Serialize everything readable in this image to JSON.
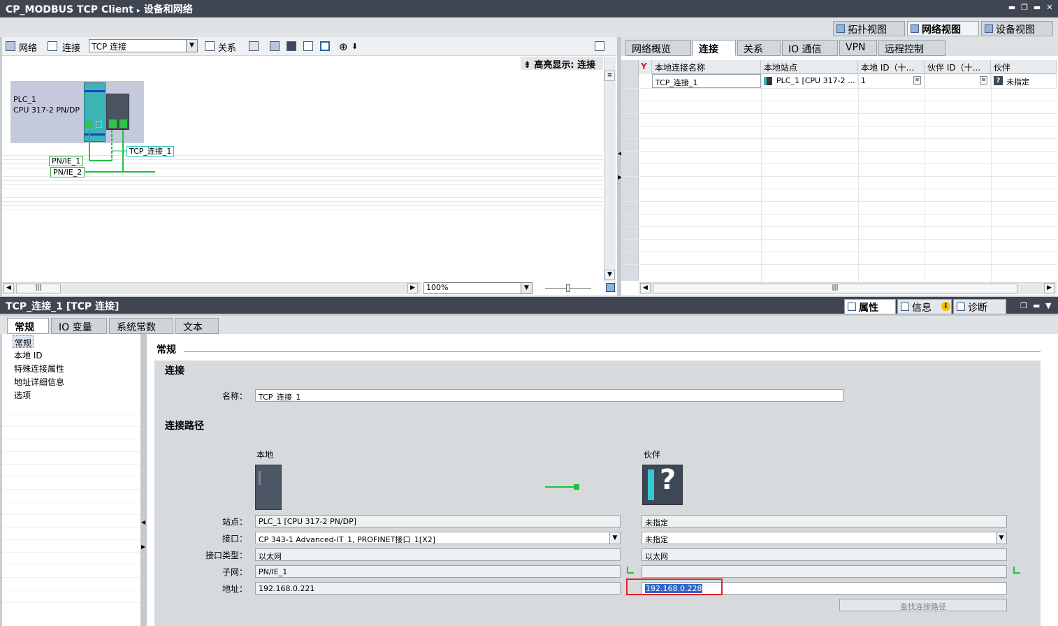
{
  "window": {
    "title": "CP_MODBUS TCP Client",
    "breadcrumb_sep": "▸",
    "breadcrumb": "设备和网络",
    "controls": [
      "▬",
      "❐",
      "▬",
      "✕"
    ]
  },
  "view_tabs": [
    {
      "label": "拓扑视图",
      "icon": "topology-view-icon"
    },
    {
      "label": "网络视图",
      "icon": "network-view-icon"
    },
    {
      "label": "设备视图",
      "icon": "device-view-icon"
    }
  ],
  "toolbar": {
    "network_label": "网络",
    "connection_label": "连接",
    "connection_type": "TCP 连接",
    "relation_label": "关系",
    "highlight": "高亮显示: 连接",
    "zoom": "100%"
  },
  "canvas": {
    "plc_name": "PLC_1",
    "plc_type": "CPU 317-2 PN/DP",
    "connection_label": "TCP_连接_1",
    "networks": [
      "PN/IE_1",
      "PN/IE_2"
    ]
  },
  "overview_tabs": [
    "网络概览",
    "连接",
    "关系",
    "IO 通信",
    "VPN",
    "远程控制"
  ],
  "overview_active": "连接",
  "grid": {
    "headers": [
      "本地连接名称",
      "本地站点",
      "本地 ID（十...",
      "伙伴 ID（十...",
      "伙伴"
    ],
    "rows": [
      {
        "name": "TCP_连接_1",
        "station": "PLC_1 [CPU 317-2 ...",
        "local_id": "1",
        "partner_id": "",
        "partner": "未指定"
      }
    ]
  },
  "inspector": {
    "title": "TCP_连接_1 [TCP 连接]",
    "tabs": [
      "属性",
      "信息",
      "诊断"
    ],
    "subtabs": [
      "常规",
      "IO 变量",
      "系统常数",
      "文本"
    ],
    "nav": [
      "常规",
      "本地 ID",
      "特殊连接属性",
      "地址详细信息",
      "选项"
    ],
    "section_title": "常规",
    "group_connection": "连接",
    "name_label": "名称：",
    "name_value": "TCP_连接_1",
    "group_path": "连接路径",
    "local_header": "本地",
    "partner_header": "伙伴",
    "row_labels": {
      "station": "站点：",
      "interface": "接口：",
      "interface_type": "接口类型：",
      "subnet": "子网：",
      "address": "地址："
    },
    "local": {
      "station": "PLC_1 [CPU 317-2 PN/DP]",
      "interface": "CP 343-1 Advanced-IT_1, PROFINET接口_1[X2]",
      "interface_type": "以太网",
      "subnet": "PN/IE_1",
      "address": "192.168.0.221"
    },
    "partner": {
      "station": "未指定",
      "interface": "未指定",
      "interface_type": "以太网",
      "subnet": "",
      "address": "192.168.0.228"
    },
    "find_path_button": "查找连接路径"
  }
}
